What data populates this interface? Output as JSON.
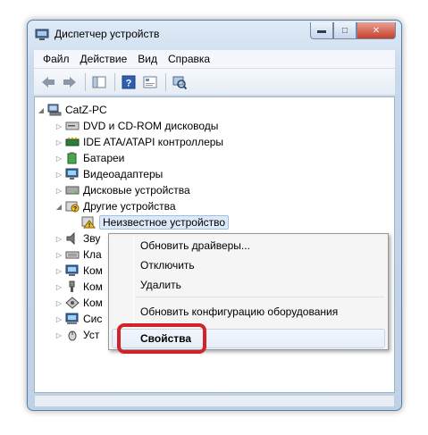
{
  "window": {
    "title": "Диспетчер устройств",
    "caption_min": "▬",
    "caption_max": "□",
    "caption_close": "✕"
  },
  "menu": [
    "Файл",
    "Действие",
    "Вид",
    "Справка"
  ],
  "toolbar": {
    "icons": [
      "back-icon",
      "forward-icon",
      "properties-pane-icon",
      "help-icon",
      "device-view-icon",
      "scan-hardware-icon"
    ]
  },
  "tree": {
    "root": "CatZ-PC",
    "items": [
      {
        "label": "DVD и CD-ROM дисководы",
        "icon": "dvd-drive-icon"
      },
      {
        "label": "IDE ATA/ATAPI контроллеры",
        "icon": "ide-controller-icon"
      },
      {
        "label": "Батареи",
        "icon": "battery-icon"
      },
      {
        "label": "Видеоадаптеры",
        "icon": "video-adapter-icon"
      },
      {
        "label": "Дисковые устройства",
        "icon": "disk-drive-icon"
      },
      {
        "label": "Другие устройства",
        "icon": "other-devices-icon"
      },
      {
        "label": "Неизвестное устройство",
        "icon": "unknown-device-warning-icon"
      },
      {
        "label": "Звуковые, видео и игровые устройства",
        "icon": "sound-icon"
      },
      {
        "label": "Клавиатуры",
        "icon": "keyboard-icon"
      },
      {
        "label": "Компьютер",
        "icon": "computer-icon"
      },
      {
        "label": "Контроллеры USB",
        "icon": "usb-icon"
      },
      {
        "label": "Контроллеры запоминающих устройств",
        "icon": "storage-controller-icon"
      },
      {
        "label": "Системные устройства",
        "icon": "system-devices-icon"
      },
      {
        "label": "Устройства HID",
        "icon": "hid-icon"
      }
    ],
    "partial_visible": [
      "Зву",
      "Кла",
      "Ком",
      "Ком",
      "Ком",
      "Сис",
      "Уст"
    ]
  },
  "context_menu": {
    "items": [
      "Обновить драйверы...",
      "Отключить",
      "Удалить",
      "Обновить конфигурацию оборудования",
      "Свойства"
    ]
  },
  "colors": {
    "highlight_ring": "#d2232a",
    "selection": "#dbe9f8"
  }
}
